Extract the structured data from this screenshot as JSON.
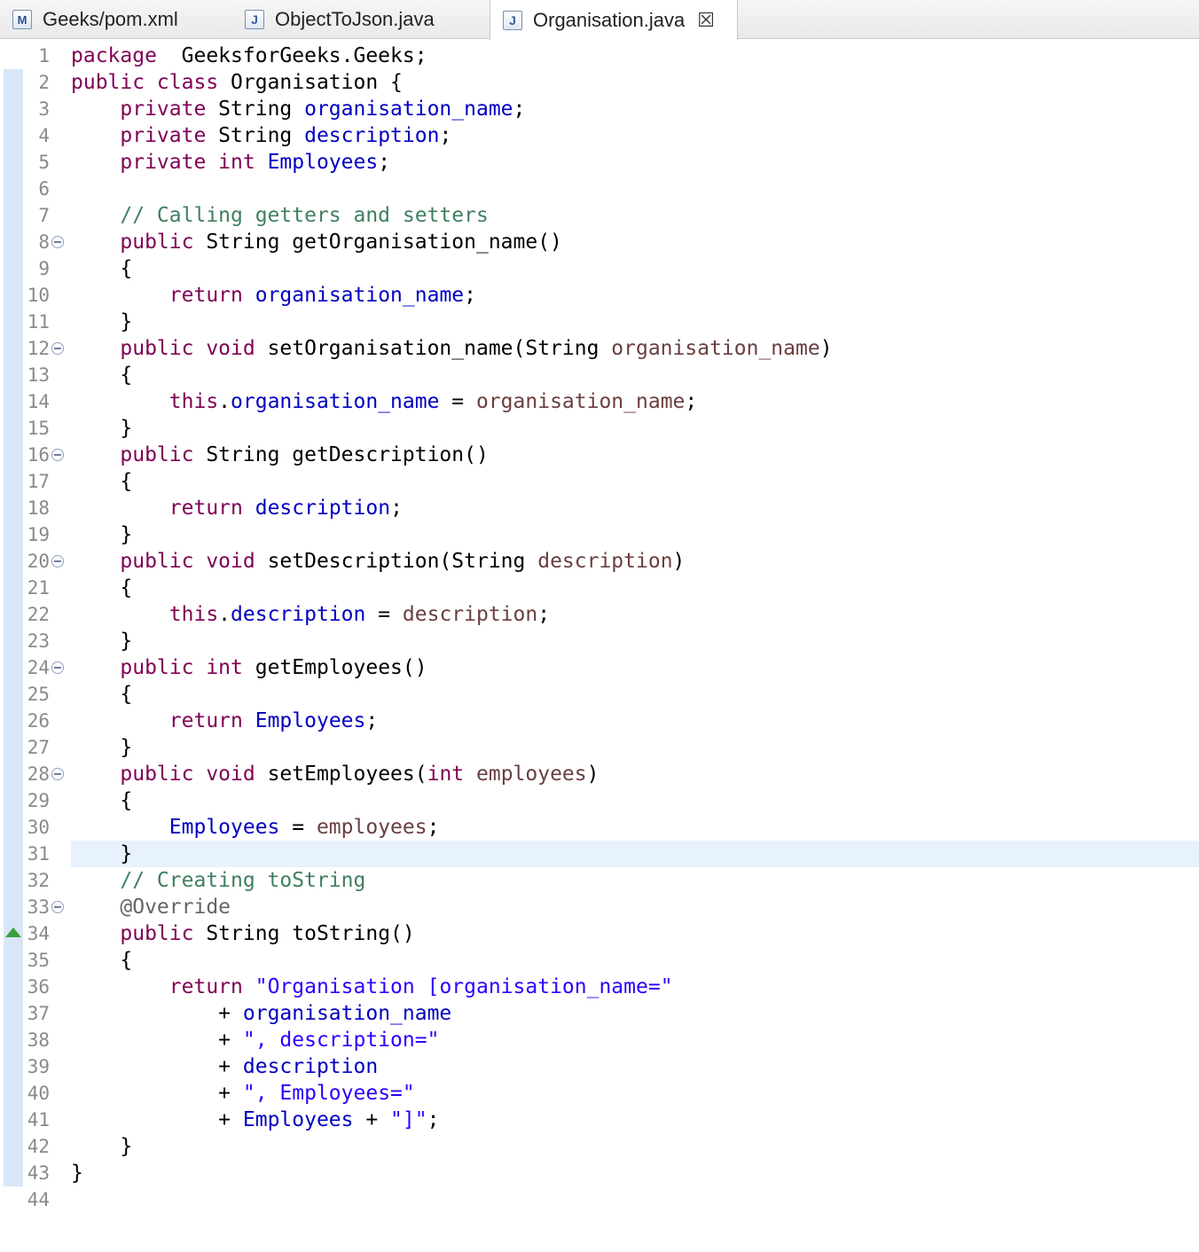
{
  "tabs": [
    {
      "label": "Geeks/pom.xml",
      "icon": "maven-file-icon",
      "icon_glyph": "M"
    },
    {
      "label": "ObjectToJson.java",
      "icon": "java-file-icon",
      "icon_glyph": "J"
    },
    {
      "label": "Organisation.java",
      "icon": "java-file-icon",
      "icon_glyph": "J",
      "active": true,
      "close_glyph": "☒"
    }
  ],
  "colors": {
    "keyword": "#7f0055",
    "field": "#0000c0",
    "string": "#2a00ff",
    "comment": "#3f7f5f",
    "annotation": "#646464",
    "parameter": "#6a3e3e",
    "current_line": "#e8f2fe"
  },
  "editor": {
    "current_line": 31,
    "lines": [
      {
        "n": "1",
        "tokens": [
          [
            "kw",
            "package"
          ],
          [
            "",
            "  GeeksforGeeks.Geeks;"
          ]
        ]
      },
      {
        "n": "2",
        "tokens": [
          [
            "kw",
            "public class"
          ],
          [
            "",
            " Organisation {"
          ]
        ]
      },
      {
        "n": "3",
        "tokens": [
          [
            "",
            "    "
          ],
          [
            "kw",
            "private"
          ],
          [
            "",
            " String "
          ],
          [
            "fld",
            "organisation_name"
          ],
          [
            "",
            ";"
          ]
        ]
      },
      {
        "n": "4",
        "tokens": [
          [
            "",
            "    "
          ],
          [
            "kw",
            "private"
          ],
          [
            "",
            " String "
          ],
          [
            "fld",
            "description"
          ],
          [
            "",
            ";"
          ]
        ]
      },
      {
        "n": "5",
        "tokens": [
          [
            "",
            "    "
          ],
          [
            "kw",
            "private int"
          ],
          [
            "",
            " "
          ],
          [
            "fld",
            "Employees"
          ],
          [
            "",
            ";"
          ]
        ]
      },
      {
        "n": "6",
        "tokens": [
          [
            "",
            ""
          ]
        ]
      },
      {
        "n": "7",
        "tokens": [
          [
            "",
            "    "
          ],
          [
            "cmt",
            "// Calling getters and setters"
          ]
        ]
      },
      {
        "n": "8",
        "fold": true,
        "tokens": [
          [
            "",
            "    "
          ],
          [
            "kw",
            "public"
          ],
          [
            "",
            " String getOrganisation_name()"
          ]
        ]
      },
      {
        "n": "9",
        "tokens": [
          [
            "",
            "    {"
          ]
        ]
      },
      {
        "n": "10",
        "tokens": [
          [
            "",
            "        "
          ],
          [
            "kw",
            "return"
          ],
          [
            "",
            " "
          ],
          [
            "fld",
            "organisation_name"
          ],
          [
            "",
            ";"
          ]
        ]
      },
      {
        "n": "11",
        "tokens": [
          [
            "",
            "    }"
          ]
        ]
      },
      {
        "n": "12",
        "fold": true,
        "tokens": [
          [
            "",
            "    "
          ],
          [
            "kw",
            "public void"
          ],
          [
            "",
            " setOrganisation_name(String "
          ],
          [
            "prm",
            "organisation_name"
          ],
          [
            "",
            ")"
          ]
        ]
      },
      {
        "n": "13",
        "tokens": [
          [
            "",
            "    {"
          ]
        ]
      },
      {
        "n": "14",
        "tokens": [
          [
            "",
            "        "
          ],
          [
            "kw",
            "this"
          ],
          [
            "",
            "."
          ],
          [
            "fld",
            "organisation_name"
          ],
          [
            "",
            " = "
          ],
          [
            "prm",
            "organisation_name"
          ],
          [
            "",
            ";"
          ]
        ]
      },
      {
        "n": "15",
        "tokens": [
          [
            "",
            "    }"
          ]
        ]
      },
      {
        "n": "16",
        "fold": true,
        "tokens": [
          [
            "",
            "    "
          ],
          [
            "kw",
            "public"
          ],
          [
            "",
            " String getDescription()"
          ]
        ]
      },
      {
        "n": "17",
        "tokens": [
          [
            "",
            "    {"
          ]
        ]
      },
      {
        "n": "18",
        "tokens": [
          [
            "",
            "        "
          ],
          [
            "kw",
            "return"
          ],
          [
            "",
            " "
          ],
          [
            "fld",
            "description"
          ],
          [
            "",
            ";"
          ]
        ]
      },
      {
        "n": "19",
        "tokens": [
          [
            "",
            "    }"
          ]
        ]
      },
      {
        "n": "20",
        "fold": true,
        "tokens": [
          [
            "",
            "    "
          ],
          [
            "kw",
            "public void"
          ],
          [
            "",
            " setDescription(String "
          ],
          [
            "prm",
            "description"
          ],
          [
            "",
            ")"
          ]
        ]
      },
      {
        "n": "21",
        "tokens": [
          [
            "",
            "    {"
          ]
        ]
      },
      {
        "n": "22",
        "tokens": [
          [
            "",
            "        "
          ],
          [
            "kw",
            "this"
          ],
          [
            "",
            "."
          ],
          [
            "fld",
            "description"
          ],
          [
            "",
            " = "
          ],
          [
            "prm",
            "description"
          ],
          [
            "",
            ";"
          ]
        ]
      },
      {
        "n": "23",
        "tokens": [
          [
            "",
            "    }"
          ]
        ]
      },
      {
        "n": "24",
        "fold": true,
        "tokens": [
          [
            "",
            "    "
          ],
          [
            "kw",
            "public int"
          ],
          [
            "",
            " getEmployees()"
          ]
        ]
      },
      {
        "n": "25",
        "tokens": [
          [
            "",
            "    {"
          ]
        ]
      },
      {
        "n": "26",
        "tokens": [
          [
            "",
            "        "
          ],
          [
            "kw",
            "return"
          ],
          [
            "",
            " "
          ],
          [
            "fld",
            "Employees"
          ],
          [
            "",
            ";"
          ]
        ]
      },
      {
        "n": "27",
        "tokens": [
          [
            "",
            "    }"
          ]
        ]
      },
      {
        "n": "28",
        "fold": true,
        "tokens": [
          [
            "",
            "    "
          ],
          [
            "kw",
            "public void"
          ],
          [
            "",
            " setEmployees("
          ],
          [
            "kw",
            "int"
          ],
          [
            "",
            " "
          ],
          [
            "prm",
            "employees"
          ],
          [
            "",
            ")"
          ]
        ]
      },
      {
        "n": "29",
        "tokens": [
          [
            "",
            "    {"
          ]
        ]
      },
      {
        "n": "30",
        "tokens": [
          [
            "",
            "        "
          ],
          [
            "fld",
            "Employees"
          ],
          [
            "",
            " = "
          ],
          [
            "prm",
            "employees"
          ],
          [
            "",
            ";"
          ]
        ]
      },
      {
        "n": "31",
        "tokens": [
          [
            "",
            "    }"
          ]
        ]
      },
      {
        "n": "32",
        "tokens": [
          [
            "",
            "    "
          ],
          [
            "cmt",
            "// Creating toString"
          ]
        ]
      },
      {
        "n": "33",
        "fold": true,
        "tokens": [
          [
            "",
            "    "
          ],
          [
            "ann",
            "@Override"
          ]
        ]
      },
      {
        "n": "34",
        "override": true,
        "tokens": [
          [
            "",
            "    "
          ],
          [
            "kw",
            "public"
          ],
          [
            "",
            " String toString()"
          ]
        ]
      },
      {
        "n": "35",
        "tokens": [
          [
            "",
            "    {"
          ]
        ]
      },
      {
        "n": "36",
        "tokens": [
          [
            "",
            "        "
          ],
          [
            "kw",
            "return"
          ],
          [
            "",
            " "
          ],
          [
            "str",
            "\"Organisation [organisation_name=\""
          ]
        ]
      },
      {
        "n": "37",
        "tokens": [
          [
            "",
            "            + "
          ],
          [
            "fld",
            "organisation_name"
          ]
        ]
      },
      {
        "n": "38",
        "tokens": [
          [
            "",
            "            + "
          ],
          [
            "str",
            "\", description=\""
          ]
        ]
      },
      {
        "n": "39",
        "tokens": [
          [
            "",
            "            + "
          ],
          [
            "fld",
            "description"
          ]
        ]
      },
      {
        "n": "40",
        "tokens": [
          [
            "",
            "            + "
          ],
          [
            "str",
            "\", Employees=\""
          ]
        ]
      },
      {
        "n": "41",
        "tokens": [
          [
            "",
            "            + "
          ],
          [
            "fld",
            "Employees"
          ],
          [
            "",
            " + "
          ],
          [
            "str",
            "\"]\""
          ],
          [
            "",
            ";"
          ]
        ]
      },
      {
        "n": "42",
        "tokens": [
          [
            "",
            "    }"
          ]
        ]
      },
      {
        "n": "43",
        "tokens": [
          [
            "",
            "}"
          ]
        ]
      },
      {
        "n": "44",
        "tokens": [
          [
            "",
            ""
          ]
        ]
      }
    ]
  }
}
